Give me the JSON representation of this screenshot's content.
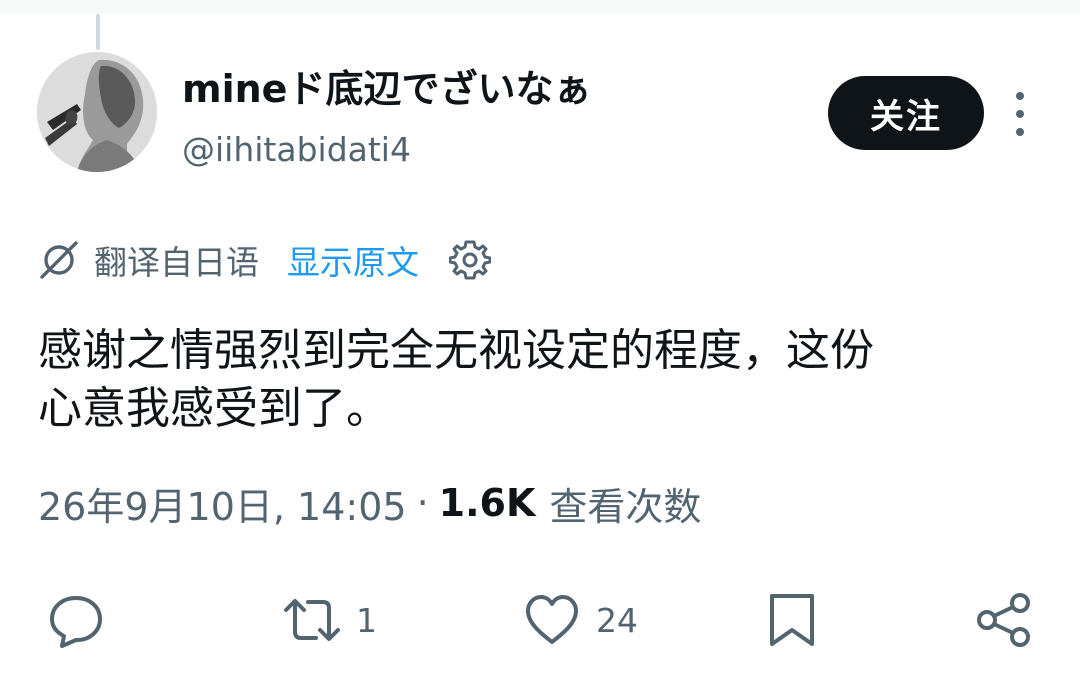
{
  "author": {
    "display_name": "mineド底辺でざいなぁ",
    "handle": "@iihitabidati4",
    "avatar_icon": "avatar-portrait"
  },
  "follow_label": "关注",
  "translation": {
    "label": "翻译自日语",
    "show_original": "显示原文",
    "accent_color": "#1d9bf0"
  },
  "tweet": {
    "text": "感谢之情强烈到完全无视设定的程度，这份\n心意我感受到了。"
  },
  "meta": {
    "timestamp": "26年9月10日, 14:05",
    "separator": "·",
    "views_count": "1.6K",
    "views_label": "查看次数"
  },
  "actions": {
    "reply": {
      "icon": "reply-icon",
      "count": ""
    },
    "retweet": {
      "icon": "retweet-icon",
      "count": "1"
    },
    "like": {
      "icon": "heart-icon",
      "count": "24"
    },
    "bookmark": {
      "icon": "bookmark-icon",
      "count": ""
    },
    "share": {
      "icon": "share-icon",
      "count": ""
    }
  },
  "colors": {
    "text": "#0f1419",
    "secondary": "#536471",
    "follow_bg": "#0f1419"
  }
}
